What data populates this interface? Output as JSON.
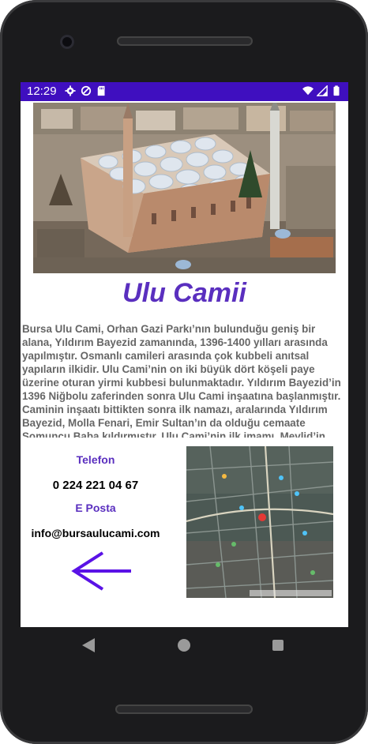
{
  "status_bar": {
    "time": "12:29",
    "icons_left": [
      "gear-icon",
      "block-icon",
      "sd-card-icon"
    ],
    "icons_right": [
      "wifi-icon",
      "signal-icon",
      "battery-icon"
    ],
    "background": "#3f0fbf"
  },
  "hero_image": {
    "subject": "mosque-photo"
  },
  "title": "Ulu Camii",
  "description": "Bursa Ulu Cami, Orhan Gazi Parkı’nın bulunduğu geniş bir alana, Yıldırım Bayezid zamanında, 1396-1400 yılları arasında yapılmıştır. Osmanlı camileri arasında çok kubbeli anıtsal yapıların ilkidir. Ulu Cami’nin on iki büyük dört köşeli paye üzerine oturan yirmi kubbesi bulunmaktadır. Yıldırım Bayezid’in 1396 Niğbolu zaferinden sonra Ulu Cami inşaatına başlanmıştır. Caminin inşaatı bittikten sonra ilk namazı,  aralarında Yıldırım Bayezid, Molla Fenari, Emir Sultan’ın  da olduğu cemaate Somuncu Baba kıldırmıştır. Ulu Cami’nin ilk imamı, Mevlid’in",
  "contact": {
    "phone_label": "Telefon",
    "phone_value": "0 224 221 04 67",
    "email_label": "E Posta",
    "email_value": "info@bursaulucami.com"
  },
  "map": {
    "type": "satellite-map"
  },
  "colors": {
    "accent": "#5a2fbf",
    "arrow": "#5a12e6",
    "text_gray": "#666666"
  }
}
